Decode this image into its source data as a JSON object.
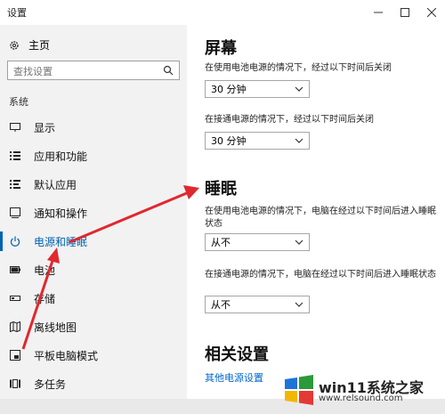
{
  "window": {
    "title": "设置",
    "min_icon": "minimize-icon",
    "max_icon": "maximize-icon",
    "close_icon": "close-icon"
  },
  "sidebar": {
    "home_label": "主页",
    "search_placeholder": "查找设置",
    "section_label": "系统",
    "items": [
      {
        "label": "显示",
        "icon": "monitor-icon"
      },
      {
        "label": "应用和功能",
        "icon": "list-icon"
      },
      {
        "label": "默认应用",
        "icon": "default-apps-icon"
      },
      {
        "label": "通知和操作",
        "icon": "notification-icon"
      },
      {
        "label": "电源和睡眠",
        "icon": "power-icon",
        "active": true
      },
      {
        "label": "电池",
        "icon": "battery-icon"
      },
      {
        "label": "存储",
        "icon": "storage-icon"
      },
      {
        "label": "离线地图",
        "icon": "map-icon"
      },
      {
        "label": "平板电脑模式",
        "icon": "tablet-icon"
      },
      {
        "label": "多任务",
        "icon": "multitask-icon"
      }
    ]
  },
  "main": {
    "screen": {
      "heading": "屏幕",
      "battery_desc": "在使用电池电源的情况下，经过以下时间后关闭",
      "battery_value": "30 分钟",
      "plugged_desc": "在接通电源的情况下，经过以下时间后关闭",
      "plugged_value": "30 分钟"
    },
    "sleep": {
      "heading": "睡眠",
      "battery_desc": "在使用电池电源的情况下，电脑在经过以下时间后进入睡眠状态",
      "battery_value": "从不",
      "plugged_desc": "在接通电源的情况下，电脑在经过以下时间后进入睡眠状态",
      "plugged_value": "从不"
    },
    "related": {
      "heading": "相关设置",
      "link": "其他电源设置"
    }
  },
  "watermark": {
    "brand": "win11系统之家",
    "url": "www.relsound.com"
  },
  "colors": {
    "accent": "#0063b1",
    "arrow": "#e0282e",
    "sidebar_bg": "#f2f2f2"
  }
}
